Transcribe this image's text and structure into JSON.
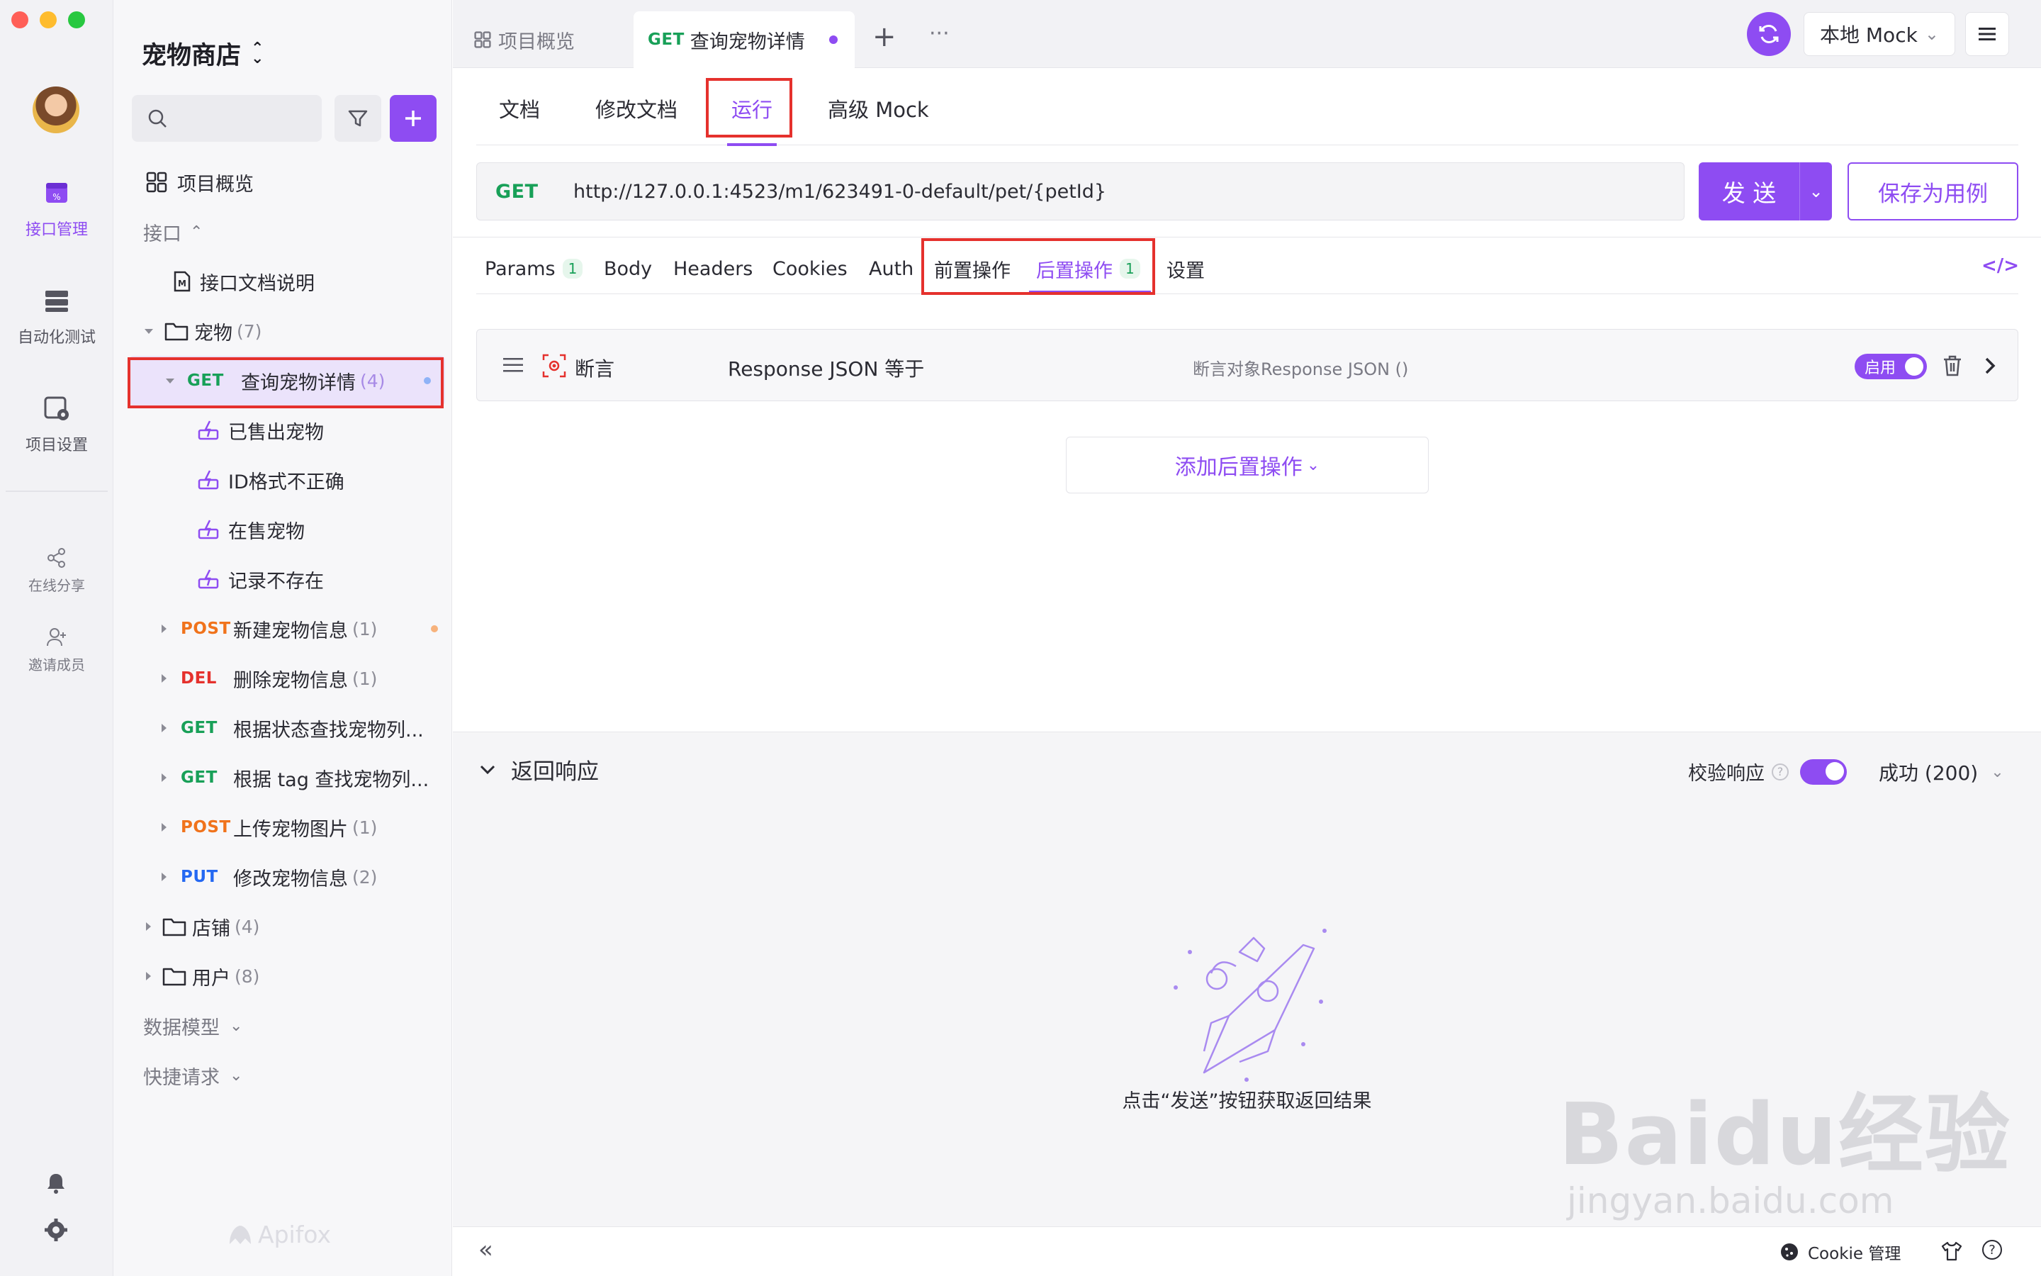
{
  "colors": {
    "accent": "#8e4cf2",
    "get": "#18a058",
    "post": "#f0731c",
    "del": "#e5312d",
    "put": "#2468f2",
    "highlight": "#e5312d"
  },
  "rail": {
    "items": [
      {
        "label": "接口管理",
        "icon": "api-management-icon",
        "active": true
      },
      {
        "label": "自动化测试",
        "icon": "automation-test-icon"
      },
      {
        "label": "项目设置",
        "icon": "project-settings-icon"
      }
    ],
    "extras": [
      {
        "label": "在线分享",
        "icon": "share-icon"
      },
      {
        "label": "邀请成员",
        "icon": "invite-member-icon"
      }
    ],
    "bottom_icons": [
      "bell-icon",
      "gear-icon"
    ]
  },
  "sidebar": {
    "project_name": "宠物商店",
    "search_placeholder": "",
    "overview": "项目概览",
    "section_api": "接口",
    "api_doc": "接口文档说明",
    "folder_pet": {
      "label": "宠物",
      "count": "(7)"
    },
    "selected": {
      "method": "GET",
      "label": "查询宠物详情",
      "count": "(4)"
    },
    "cases": [
      "已售出宠物",
      "ID格式不正确",
      "在售宠物",
      "记录不存在"
    ],
    "endpoints": [
      {
        "method": "POST",
        "label": "新建宠物信息",
        "count": "(1)",
        "dot": true
      },
      {
        "method": "DEL",
        "label": "删除宠物信息",
        "count": "(1)"
      },
      {
        "method": "GET",
        "label": "根据状态查找宠物列...",
        "count": ""
      },
      {
        "method": "GET",
        "label": "根据 tag 查找宠物列...",
        "count": ""
      },
      {
        "method": "POST",
        "label": "上传宠物图片",
        "count": "(1)"
      },
      {
        "method": "PUT",
        "label": "修改宠物信息",
        "count": "(2)"
      }
    ],
    "folders": [
      {
        "label": "店铺",
        "count": "(4)"
      },
      {
        "label": "用户",
        "count": "(8)"
      }
    ],
    "data_model": "数据模型",
    "quick_request": "快捷请求",
    "brand": "Apifox"
  },
  "tabs": {
    "overview": "项目概览",
    "active_method": "GET",
    "active_label": "查询宠物详情",
    "env": "本地 Mock"
  },
  "subtabs": [
    "文档",
    "修改文档",
    "运行",
    "高级 Mock"
  ],
  "request": {
    "method": "GET",
    "url": "http://127.0.0.1:4523/m1/623491-0-default/pet/{petId}",
    "send": "发 送",
    "save": "保存为用例"
  },
  "param_tabs": {
    "params": "Params",
    "params_count": "1",
    "body": "Body",
    "headers": "Headers",
    "cookies": "Cookies",
    "auth": "Auth",
    "pre": "前置操作",
    "post": "后置操作",
    "post_count": "1",
    "settings": "设置"
  },
  "assertion": {
    "type": "断言",
    "name": "Response JSON 等于",
    "target": "断言对象Response JSON ()",
    "enabled_label": "启用"
  },
  "add_post_op": "添加后置操作",
  "response": {
    "title": "返回响应",
    "validate_label": "校验响应",
    "status": "成功 (200)",
    "empty_hint": "点击“发送”按钮获取返回结果"
  },
  "bottom": {
    "cookie": "Cookie 管理"
  },
  "watermark": {
    "text": "Baidu经验",
    "url": "jingyan.baidu.com"
  }
}
